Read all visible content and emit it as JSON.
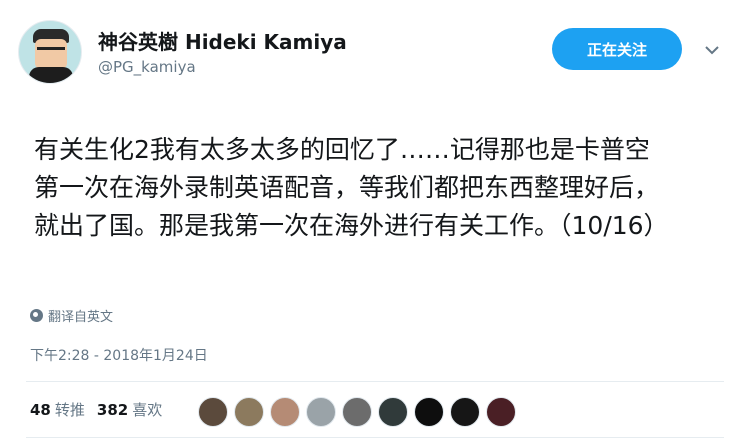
{
  "user": {
    "display_name": "神谷英樹 Hideki Kamiya",
    "handle": "@PG_kamiya"
  },
  "actions": {
    "follow_label": "正在关注",
    "caret_icon": "chevron-down-icon"
  },
  "tweet": {
    "line1": "有关生化2我有太多太多的回忆了……记得那也是卡普空",
    "line2": "第一次在海外录制英语配音，等我们都把东西整理好后，",
    "line3": "就出了国。那是我第一次在海外进行有关工作。（10/16）",
    "translate_label": "翻译自英文",
    "timestamp": "下午2:28 - 2018年1月24日"
  },
  "stats": {
    "retweets_count": "48",
    "retweets_label": "转推",
    "likes_count": "382",
    "likes_label": "喜欢"
  },
  "likers": {
    "colors": [
      "#5b4a3c",
      "#8c7a5e",
      "#b58b75",
      "#9aa3a8",
      "#6c6c6c",
      "#303a3a",
      "#0e0e0e",
      "#161616",
      "#4a1f25"
    ]
  }
}
